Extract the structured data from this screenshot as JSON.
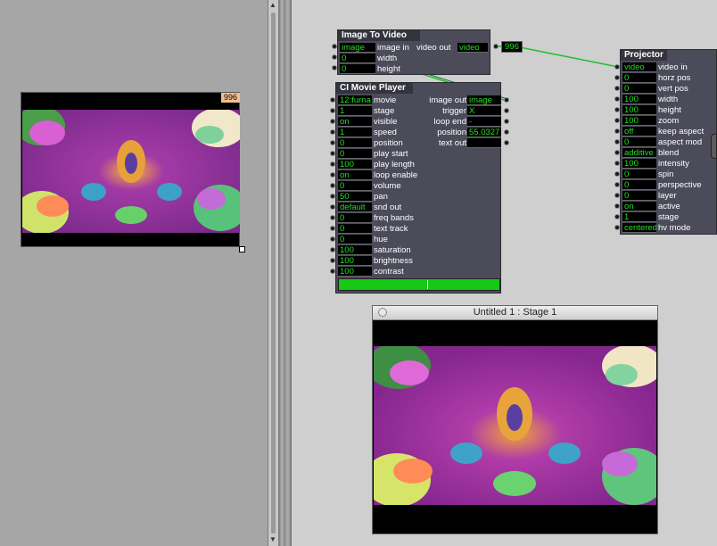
{
  "colors": {
    "value_text": "#22e022",
    "actor_body": "#4b4b5a",
    "link": "#1fbf2a",
    "progress": "#15c915"
  },
  "preview": {
    "badge": "996"
  },
  "image_to_video": {
    "title": "Image To Video",
    "inputs": [
      {
        "value": "image",
        "label": "image in"
      },
      {
        "value": "0",
        "label": "width"
      },
      {
        "value": "0",
        "label": "height"
      }
    ],
    "output_label": "video out",
    "output_value": "video",
    "tag": "996"
  },
  "movie_player": {
    "title": "CI Movie Player",
    "inputs": [
      {
        "value": "12:furna",
        "label": "movie"
      },
      {
        "value": "1",
        "label": "stage"
      },
      {
        "value": "on",
        "label": "visible"
      },
      {
        "value": "1",
        "label": "speed"
      },
      {
        "value": "0",
        "label": "position"
      },
      {
        "value": "0",
        "label": "play start"
      },
      {
        "value": "100",
        "label": "play length"
      },
      {
        "value": "on",
        "label": "loop enable"
      },
      {
        "value": "0",
        "label": "volume"
      },
      {
        "value": "50",
        "label": "pan"
      },
      {
        "value": "default",
        "label": "snd out"
      },
      {
        "value": "0",
        "label": "freq bands"
      },
      {
        "value": "0",
        "label": "text track"
      },
      {
        "value": "0",
        "label": "hue"
      },
      {
        "value": "100",
        "label": "saturation"
      },
      {
        "value": "100",
        "label": "brightness"
      },
      {
        "value": "100",
        "label": "contrast"
      }
    ],
    "outputs": [
      {
        "label": "image out",
        "value": "image"
      },
      {
        "label": "trigger",
        "value": "X"
      },
      {
        "label": "loop end",
        "value": "-"
      },
      {
        "label": "position",
        "value": "55.0327"
      },
      {
        "label": "text out",
        "value": ""
      }
    ],
    "progress": 0.55
  },
  "projector": {
    "title": "Projector",
    "inputs": [
      {
        "value": "video",
        "label": "video in"
      },
      {
        "value": "0",
        "label": "horz pos"
      },
      {
        "value": "0",
        "label": "vert pos"
      },
      {
        "value": "100",
        "label": "width"
      },
      {
        "value": "100",
        "label": "height"
      },
      {
        "value": "100",
        "label": "zoom"
      },
      {
        "value": "off",
        "label": "keep aspect"
      },
      {
        "value": "0",
        "label": "aspect mod"
      },
      {
        "value": "additive",
        "label": "blend"
      },
      {
        "value": "100",
        "label": "intensity"
      },
      {
        "value": "0",
        "label": "spin"
      },
      {
        "value": "0",
        "label": "perspective"
      },
      {
        "value": "0",
        "label": "layer"
      },
      {
        "value": "on",
        "label": "active"
      },
      {
        "value": "1",
        "label": "stage"
      },
      {
        "value": "centered",
        "label": "hv mode"
      }
    ]
  },
  "stage_window": {
    "title": "Untitled 1 : Stage 1"
  }
}
